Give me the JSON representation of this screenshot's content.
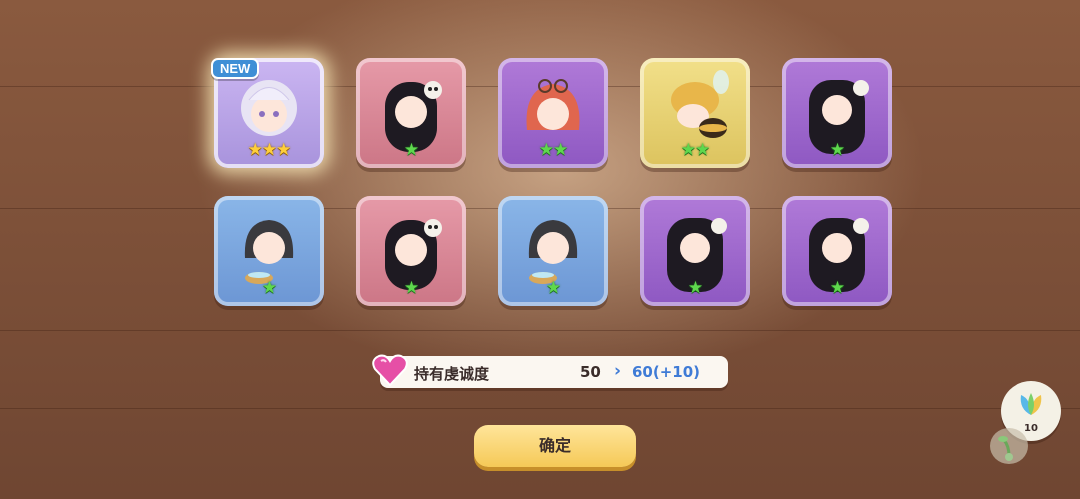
{
  "new_badge": "NEW",
  "cards": [
    {
      "color": "special",
      "stars": 3,
      "star_color": "gold",
      "icon": "white-haired-girl-portrait"
    },
    {
      "color": "pink",
      "stars": 1,
      "star_color": "green",
      "icon": "black-haired-skull-girl-portrait"
    },
    {
      "color": "purple",
      "stars": 2,
      "star_color": "green",
      "icon": "red-haired-goggles-girl-portrait"
    },
    {
      "color": "yellow",
      "stars": 2,
      "star_color": "green",
      "icon": "bee-creature-portrait"
    },
    {
      "color": "purple",
      "stars": 1,
      "star_color": "green",
      "icon": "long-black-haired-girl-portrait"
    },
    {
      "color": "blue",
      "stars": 1,
      "star_color": "green",
      "icon": "dark-haired-bowl-girl-portrait"
    },
    {
      "color": "pink",
      "stars": 1,
      "star_color": "green",
      "icon": "black-haired-skull-girl-portrait"
    },
    {
      "color": "blue",
      "stars": 1,
      "star_color": "green",
      "icon": "dark-haired-bowl-girl-portrait"
    },
    {
      "color": "purple",
      "stars": 1,
      "star_color": "green",
      "icon": "long-black-haired-girl-portrait"
    },
    {
      "color": "purple",
      "stars": 1,
      "star_color": "green",
      "icon": "long-black-haired-girl-portrait"
    }
  ],
  "stat": {
    "label": "持有虔诚度",
    "old_value": "50",
    "arrow": "›",
    "new_value": "60(+10)",
    "icon": "heart-gem-icon"
  },
  "confirm_label": "确定",
  "side": {
    "gem_count": "10",
    "gem_icon": "sprout-gem-icon",
    "sub_icon": "sprout-icon"
  }
}
